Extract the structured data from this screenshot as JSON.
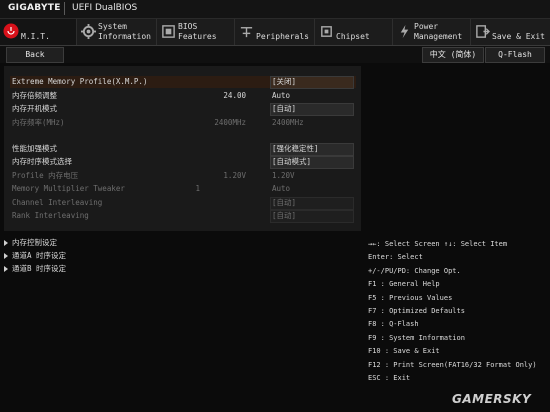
{
  "header": {
    "brand": "GIGABYTE",
    "product": "UEFI DualBIOS"
  },
  "tabs": [
    {
      "label": "M.I.T.",
      "icon": "mit-icon"
    },
    {
      "label": "System\nInformation",
      "icon": "system-info-icon"
    },
    {
      "label": "BIOS\nFeatures",
      "icon": "bios-features-icon"
    },
    {
      "label": "Peripherals",
      "icon": "peripherals-icon"
    },
    {
      "label": "Chipset",
      "icon": "chipset-icon"
    },
    {
      "label": "Power\nManagement",
      "icon": "power-icon"
    },
    {
      "label": "Save & Exit",
      "icon": "save-exit-icon"
    }
  ],
  "toolbar": {
    "back": "Back",
    "language": "中文 (简体)",
    "qflash": "Q-Flash"
  },
  "settings": [
    {
      "label": "Extreme Memory Profile(X.M.P.)",
      "mid": "",
      "value": "[关闭]"
    },
    {
      "label": "内存倍频调整",
      "mid": "24.00",
      "value": "Auto"
    },
    {
      "label": "内存开机模式",
      "mid": "",
      "value": "[自动]"
    },
    {
      "label": "内存频率(MHz)",
      "mid": "2400MHz",
      "value": "2400MHz"
    },
    {
      "label": "性能加强模式",
      "mid": "",
      "value": "[强化稳定性]"
    },
    {
      "label": "内存时序模式选择",
      "mid": "",
      "value": "[自动模式]"
    },
    {
      "label": "Profile 内存电压",
      "mid": "1.20V",
      "value": "1.20V"
    },
    {
      "label": "Memory Multiplier Tweaker",
      "mid": "1",
      "value": "Auto"
    },
    {
      "label": "Channel Interleaving",
      "mid": "",
      "value": "[自动]"
    },
    {
      "label": "Rank Interleaving",
      "mid": "",
      "value": "[自动]"
    }
  ],
  "submenus": [
    {
      "label": "内存控制设定"
    },
    {
      "label": "通道A 时序设定"
    },
    {
      "label": "通道B 时序设定"
    }
  ],
  "help": [
    "→←: Select Screen  ↑↓: Select Item",
    "Enter: Select",
    "+/-/PU/PD: Change Opt.",
    "F1  : General Help",
    "F5  : Previous Values",
    "F7  : Optimized Defaults",
    "F8  : Q-Flash",
    "F9  : System Information",
    "F10 : Save & Exit",
    "F12 : Print Screen(FAT16/32 Format Only)",
    "ESC : Exit"
  ],
  "watermark": "GAMERSKY",
  "colors": {
    "accent_red": "#d8111a",
    "highlight_row": "#2c1c12",
    "background": "#0b0b0b"
  }
}
